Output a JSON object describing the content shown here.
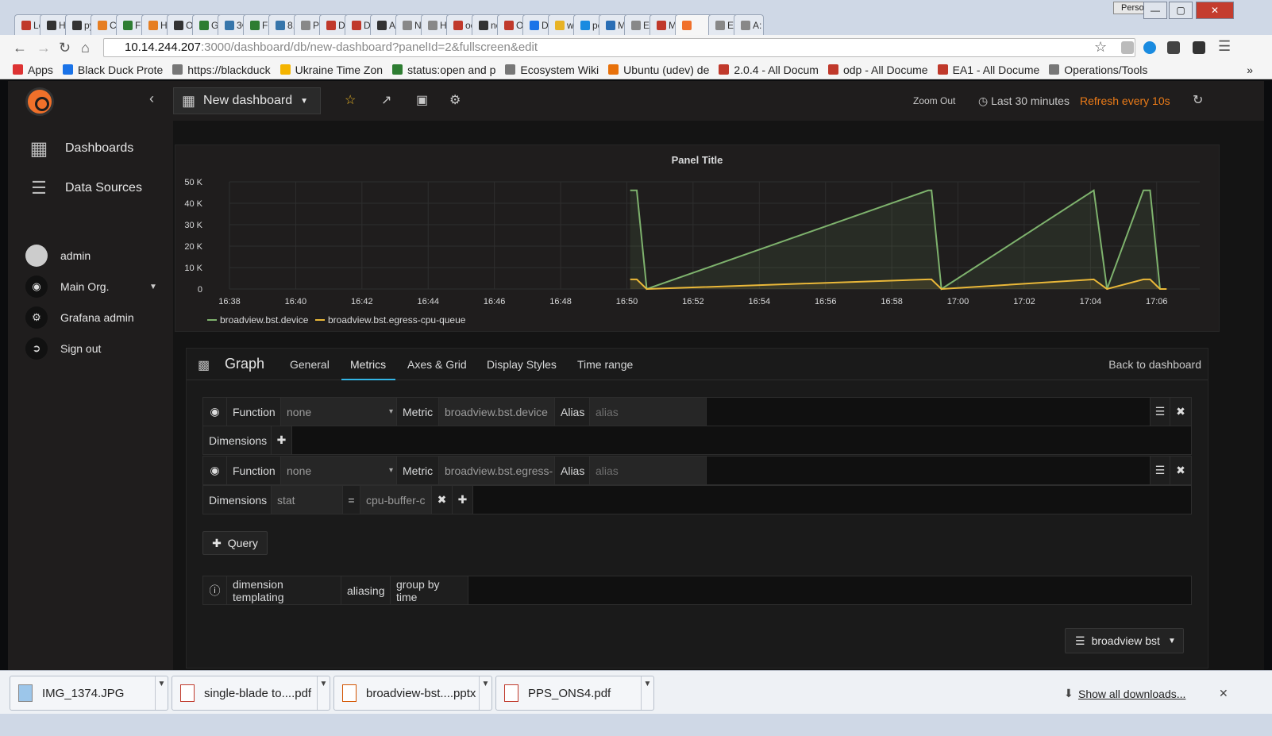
{
  "browser": {
    "person_label": "Person 1",
    "tabs": [
      "Lc",
      "H",
      "py",
      "Cc",
      "Fc",
      "H",
      "Oj",
      "Gi",
      "3€",
      "Fc",
      "8.",
      "Pc",
      "Di",
      "Di",
      "Ac",
      "N",
      "H",
      "oc",
      "nc",
      "O",
      "D",
      "w",
      "pc",
      "M",
      "Ec",
      "M",
      "",
      "Ec",
      "A:"
    ],
    "url_host": "10.14.244.207",
    "url_path": ":3000/dashboard/db/new-dashboard?panelId=2&fullscreen&edit",
    "bookmarks": [
      "Apps",
      "Black Duck Prote",
      "https://blackduck",
      "Ukraine Time Zon",
      "status:open and p",
      "Ecosystem Wiki",
      "Ubuntu (udev) de",
      "2.0.4 - All Docum",
      "odp - All Docume",
      "EA1 - All Docume",
      "Operations/Tools"
    ],
    "more_bookmarks": "»"
  },
  "topnav": {
    "dashboard_title": "New dashboard",
    "zoom_out": "Zoom Out",
    "time_range": "Last 30 minutes",
    "refresh": "Refresh every 10s"
  },
  "sidemenu": {
    "dashboards": "Dashboards",
    "data_sources": "Data Sources",
    "user": "admin",
    "org": "Main Org.",
    "grafana_admin": "Grafana admin",
    "sign_out": "Sign out"
  },
  "panel": {
    "title": "Panel Title"
  },
  "chart_data": {
    "type": "line",
    "title": "Panel Title",
    "x_ticks": [
      "16:38",
      "16:40",
      "16:42",
      "16:44",
      "16:46",
      "16:48",
      "16:50",
      "16:52",
      "16:54",
      "16:56",
      "16:58",
      "17:00",
      "17:02",
      "17:04",
      "17:06"
    ],
    "y_ticks": [
      "0",
      "10 K",
      "20 K",
      "30 K",
      "40 K",
      "50 K"
    ],
    "ylim": [
      0,
      50000
    ],
    "xlim_minutes": [
      0,
      29.3
    ],
    "grid": true,
    "legend_placement": "bottom-left",
    "series": [
      {
        "name": "broadview.bst.device",
        "color": "#7eb26d",
        "points": [
          [
            12.1,
            46000
          ],
          [
            12.3,
            46000
          ],
          [
            12.6,
            0
          ],
          [
            21.1,
            46000
          ],
          [
            21.2,
            46000
          ],
          [
            21.5,
            0
          ],
          [
            26.1,
            46000
          ],
          [
            26.5,
            0
          ],
          [
            27.6,
            46000
          ],
          [
            27.8,
            46000
          ],
          [
            28.1,
            0
          ]
        ]
      },
      {
        "name": "broadview.bst.egress-cpu-queue",
        "color": "#eab839",
        "points": [
          [
            12.1,
            4500
          ],
          [
            12.3,
            4500
          ],
          [
            12.6,
            0
          ],
          [
            21.1,
            4500
          ],
          [
            21.2,
            4500
          ],
          [
            21.5,
            0
          ],
          [
            26.1,
            4500
          ],
          [
            26.5,
            0
          ],
          [
            27.6,
            4500
          ],
          [
            27.8,
            4500
          ],
          [
            28.1,
            0
          ],
          [
            28.3,
            0
          ]
        ]
      }
    ]
  },
  "editor": {
    "panel_type": "Graph",
    "tabs": [
      "General",
      "Metrics",
      "Axes & Grid",
      "Display Styles",
      "Time range"
    ],
    "active_tab": "Metrics",
    "back": "Back to dashboard",
    "queries": [
      {
        "function_label": "Function",
        "function_value": "none",
        "metric_label": "Metric",
        "metric_value": "broadview.bst.device",
        "alias_label": "Alias",
        "alias_placeholder": "alias",
        "dimensions_label": "Dimensions"
      },
      {
        "function_label": "Function",
        "function_value": "none",
        "metric_label": "Metric",
        "metric_value": "broadview.bst.egress-",
        "alias_label": "Alias",
        "alias_placeholder": "alias",
        "dimensions_label": "Dimensions",
        "dim_key": "stat",
        "dim_eq": "=",
        "dim_value": "cpu-buffer-c"
      }
    ],
    "add_query": "Query",
    "help_items": [
      "dimension templating",
      "aliasing",
      "group by time"
    ],
    "datasource": "broadview bst"
  },
  "downloads": {
    "items": [
      "IMG_1374.JPG",
      "single-blade to....pdf",
      "broadview-bst....pptx",
      "PPS_ONS4.pdf"
    ],
    "show_all": "Show all downloads..."
  }
}
